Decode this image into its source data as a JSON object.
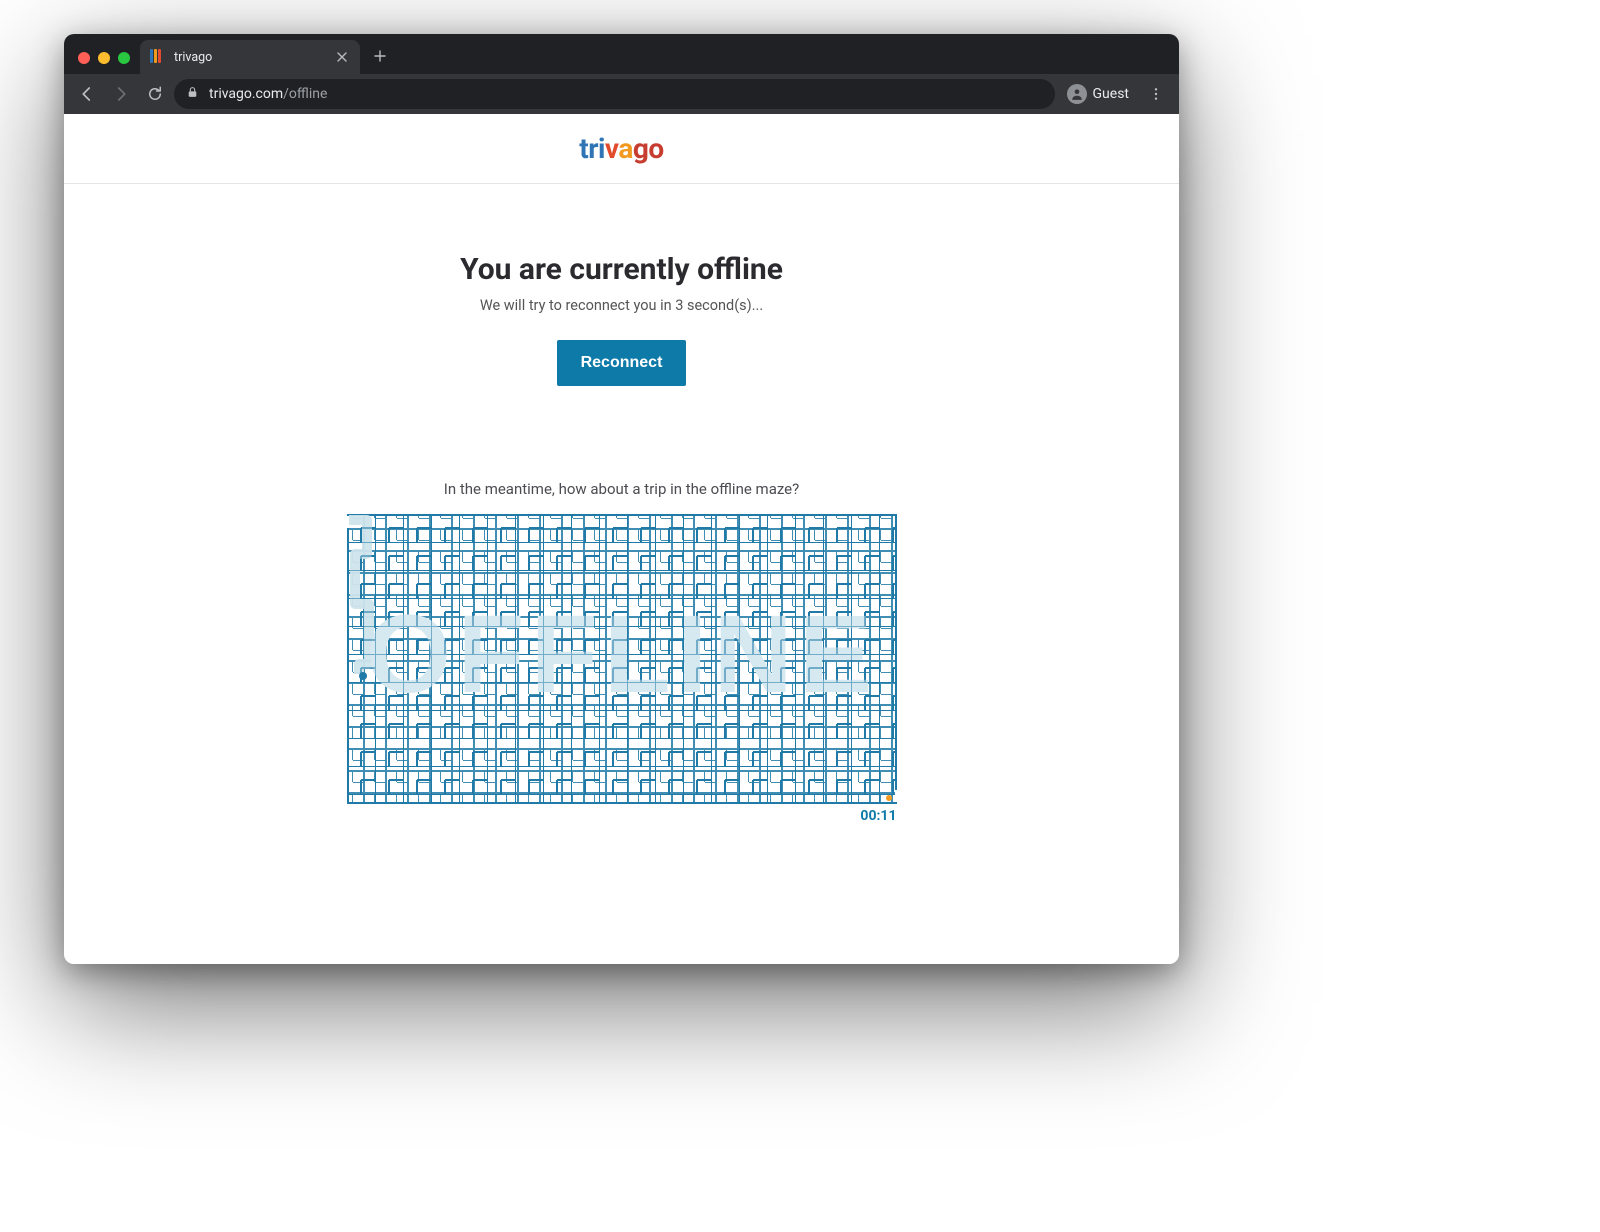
{
  "browser": {
    "tab_title": "trivago",
    "url_host": "trivago.com",
    "url_path": "/offline",
    "guest_label": "Guest"
  },
  "brand": {
    "seg_tri": "tri",
    "seg_v": "v",
    "seg_a": "a",
    "seg_go": "go"
  },
  "offline": {
    "heading": "You are currently offline",
    "subtext": "We will try to reconnect you in 3 second(s)...",
    "button_label": "Reconnect"
  },
  "maze": {
    "caption": "In the meantime, how about a trip in the offline maze?",
    "word": "OFFLINE",
    "timer": "00:11"
  },
  "colors": {
    "accent": "#0e7aa8",
    "maze_line": "#1f7aa8",
    "maze_fill": "#d7e9f0"
  }
}
